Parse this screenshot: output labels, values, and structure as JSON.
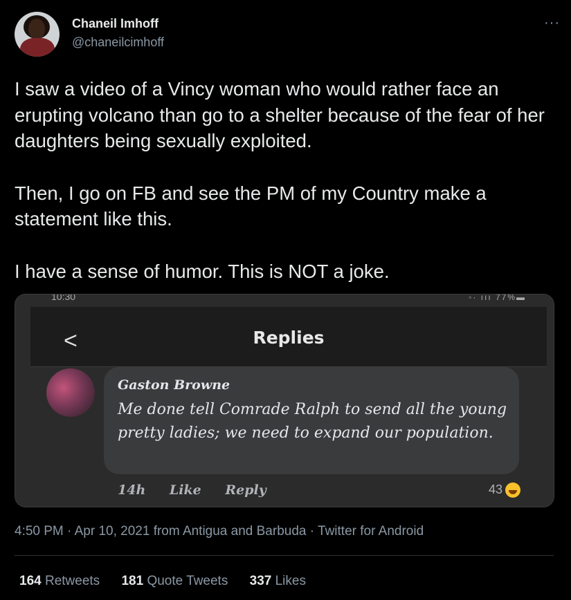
{
  "user": {
    "name": "Chaneil Imhoff",
    "handle": "@chaneilcimhoff",
    "more_glyph": "···"
  },
  "tweet": {
    "paragraphs": [
      "I saw a video of a Vincy woman who would rather face an erupting volcano than go to a shelter because of the fear of her daughters being sexually exploited.",
      "Then, I go on FB and see the PM of my Country make a statement like this.",
      "I have a sense of humor. This is NOT a joke."
    ]
  },
  "media": {
    "status_time": "10:30",
    "status_right": "◦· ııı 77%▬",
    "header_title": "Replies",
    "back_icon": "<",
    "comment_author": "Gaston Browne",
    "comment_text": "Me done tell Comrade Ralph to send all the young pretty ladies; we need to expand our population.",
    "comment_age": "14h",
    "like_label": "Like",
    "reply_label": "Reply",
    "reaction_count": "43"
  },
  "meta": {
    "time": "4:50 PM",
    "date": "Apr 10, 2021",
    "location_prefix": "from",
    "location": "Antigua and Barbuda",
    "client": "Twitter for Android",
    "separator": " · "
  },
  "stats": {
    "retweets_count": "164",
    "retweets_label": "Retweets",
    "quotes_count": "181",
    "quotes_label": "Quote Tweets",
    "likes_count": "337",
    "likes_label": "Likes"
  },
  "colors": {
    "background": "#000000",
    "text_primary": "#e7e9ea",
    "text_secondary": "#8b98a5"
  }
}
